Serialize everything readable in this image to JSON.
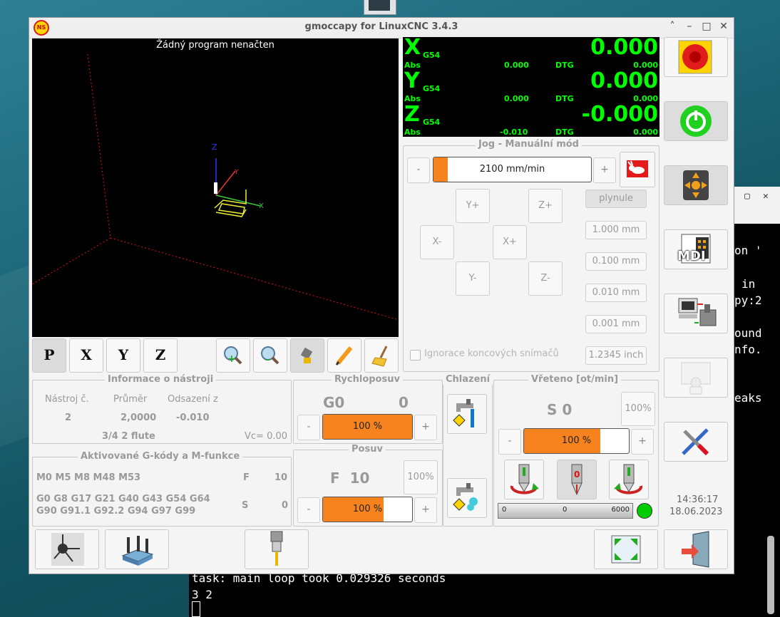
{
  "window": {
    "title": "gmoccapy for LinuxCNC  3.4.3",
    "icon_text": "NS",
    "controls": [
      "–",
      "˄",
      "□",
      "✕"
    ]
  },
  "preview": {
    "message": "Žádný program nenačten",
    "axis_labels": {
      "x": "X",
      "y": "Y",
      "z": "Z"
    }
  },
  "preview_toolbar": {
    "view_p": "P",
    "view_x": "X",
    "view_y": "Y",
    "view_z": "Z"
  },
  "dro": [
    {
      "axis": "X",
      "offset": "G54",
      "value": "0.000",
      "abs_label": "Abs",
      "abs": "0.000",
      "dtg_label": "DTG",
      "dtg": "0.000"
    },
    {
      "axis": "Y",
      "offset": "G54",
      "value": "0.000",
      "abs_label": "Abs",
      "abs": "0.000",
      "dtg_label": "DTG",
      "dtg": "0.000"
    },
    {
      "axis": "Z",
      "offset": "G54",
      "value": "-0.000",
      "abs_label": "Abs",
      "abs": "-0.010",
      "dtg_label": "DTG",
      "dtg": "0.000"
    }
  ],
  "jog": {
    "title": "Jog - Manuální mód",
    "minus": "-",
    "plus": "+",
    "speed": "2100 mm/min",
    "speed_fraction": 0.09,
    "buttons": {
      "y_plus": "Y+",
      "z_plus": "Z+",
      "x_minus": "X-",
      "x_plus": "X+",
      "y_minus": "Y-",
      "z_minus": "Z-"
    },
    "increments": [
      "plynule",
      "1.000 mm",
      "0.100 mm",
      "0.010 mm",
      "0.001 mm",
      "1.2345 inch"
    ],
    "ignore_limits": "Ignorace koncových snímačů"
  },
  "tool_info": {
    "title": "Informace o nástroji",
    "headers": [
      "Nástroj č.",
      "Průměr",
      "Odsazení z"
    ],
    "values": [
      "2",
      "2,0000",
      "-0.010"
    ],
    "description": "3/4 2 flute",
    "vc": "Vc= 0.00"
  },
  "gcodes": {
    "title": "Aktivované G-kódy a M-funkce",
    "m_codes": "M0 M5 M8 M48 M53",
    "g_line1": "G0 G8 G17 G21 G40 G43 G54 G64",
    "g_line2": " G90 G91.1 G92.2 G94 G97 G99",
    "f_label": "F",
    "f_value": "10",
    "s_label": "S",
    "s_value": "0"
  },
  "rapid": {
    "title": "Rychloposuv",
    "mode": "G0",
    "value": "0",
    "minus": "-",
    "plus": "+",
    "override": "100 %",
    "override_fraction": 1.0
  },
  "feed": {
    "title": "Posuv",
    "value": "F  10",
    "reset": "100%",
    "minus": "-",
    "plus": "+",
    "override": "100 %",
    "override_fraction": 0.68
  },
  "coolant": {
    "title": "Chlazení"
  },
  "spindle": {
    "title": "Vřeteno [ot/min]",
    "value": "S 0",
    "reset": "100%",
    "minus": "-",
    "plus": "+",
    "override": "100 %",
    "override_fraction": 0.73,
    "bar_min": "0",
    "bar_value": "0",
    "bar_max": "6000",
    "led_color": "#00cc00"
  },
  "clock": {
    "time": "14:36:17",
    "date": "18.06.2023"
  },
  "right_buttons": {
    "mdi_label": "MDI"
  },
  "terminal": {
    "lines": [
      "on '",
      "in",
      "py:2",
      "ound",
      "nfo.",
      "eaks"
    ],
    "bottom1": "task: main loop took 0.029326 seconds",
    "bottom2": "3 2"
  },
  "colors": {
    "accent": "#f7831f",
    "dro_green": "#00ff00"
  }
}
